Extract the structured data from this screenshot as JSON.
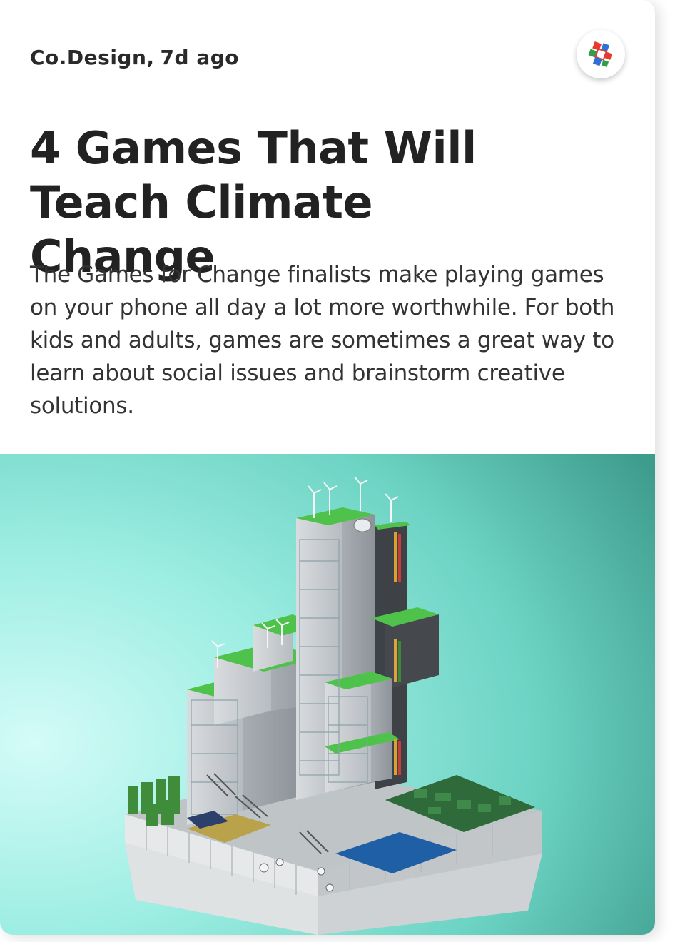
{
  "article": {
    "source": "Co.Design",
    "time": "7d ago",
    "title": "4 Games That Will Teach Climate Change",
    "description": "The Games for Change finalists make playing games on your phone all day a lot more worthwhile. For both kids and adults, games are sometimes a great way to learn about social issues and brainstorm creative solutions."
  },
  "icons": {
    "publisher_logo": "publisher-logo-icon"
  },
  "colors": {
    "sky_light": "#bff5f0",
    "sky_mid": "#7ee0d4",
    "sky_dark": "#3fa89a",
    "grass": "#4cc34a",
    "building": "#c9cccf",
    "water": "#1e5fa8"
  }
}
